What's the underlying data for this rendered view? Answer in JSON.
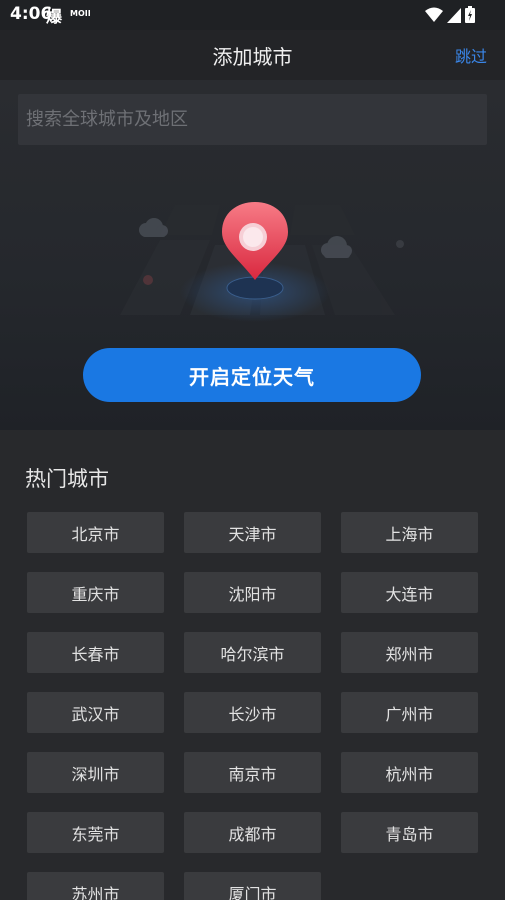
{
  "status_bar": {
    "time": "4:06",
    "left_icon_char": "爆",
    "left_icon2_text": "MOII"
  },
  "header": {
    "title": "添加城市",
    "skip_label": "跳过"
  },
  "search": {
    "placeholder": "搜索全球城市及地区",
    "value": ""
  },
  "locate": {
    "button_label": "开启定位天气"
  },
  "hot_cities": {
    "title": "热门城市",
    "items": [
      "北京市",
      "天津市",
      "上海市",
      "重庆市",
      "沈阳市",
      "大连市",
      "长春市",
      "哈尔滨市",
      "郑州市",
      "武汉市",
      "长沙市",
      "广州市",
      "深圳市",
      "南京市",
      "杭州市",
      "东莞市",
      "成都市",
      "青岛市",
      "苏州市",
      "厦门市"
    ]
  },
  "colors": {
    "accent": "#1a78e3",
    "link": "#3a86e8",
    "pin": "#e8455a",
    "background": "#232427"
  },
  "icons": [
    "wifi-icon",
    "signal-icon",
    "battery-icon",
    "location-pin-icon",
    "cloud-icon"
  ]
}
